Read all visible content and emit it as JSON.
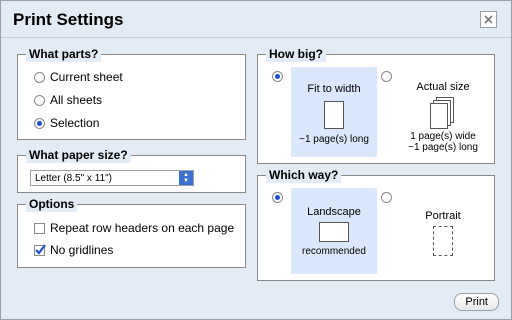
{
  "dialog": {
    "title": "Print Settings"
  },
  "what_parts": {
    "legend": "What parts?",
    "options": [
      "Current sheet",
      "All sheets",
      "Selection"
    ],
    "selected": "Selection"
  },
  "paper_size": {
    "legend": "What paper size?",
    "value": "Letter (8.5\" x 11\")"
  },
  "options": {
    "legend": "Options",
    "repeat_headers": {
      "label": "Repeat row headers on each page",
      "checked": false
    },
    "no_gridlines": {
      "label": "No gridlines",
      "checked": true
    }
  },
  "how_big": {
    "legend": "How big?",
    "fit_to_width": {
      "label": "Fit to width",
      "caption": "~1 page(s) long",
      "selected": true
    },
    "actual_size": {
      "label": "Actual size",
      "caption_line1": "1 page(s) wide",
      "caption_line2": "~1 page(s) long",
      "selected": false
    }
  },
  "which_way": {
    "legend": "Which way?",
    "landscape": {
      "label": "Landscape",
      "caption": "recommended",
      "selected": true
    },
    "portrait": {
      "label": "Portrait",
      "selected": false
    }
  },
  "buttons": {
    "print": "Print"
  },
  "colors": {
    "panel_bg": "#e3ebf5",
    "selected_bg": "#dbe8fb",
    "radio_dot": "#1a4fd6"
  }
}
